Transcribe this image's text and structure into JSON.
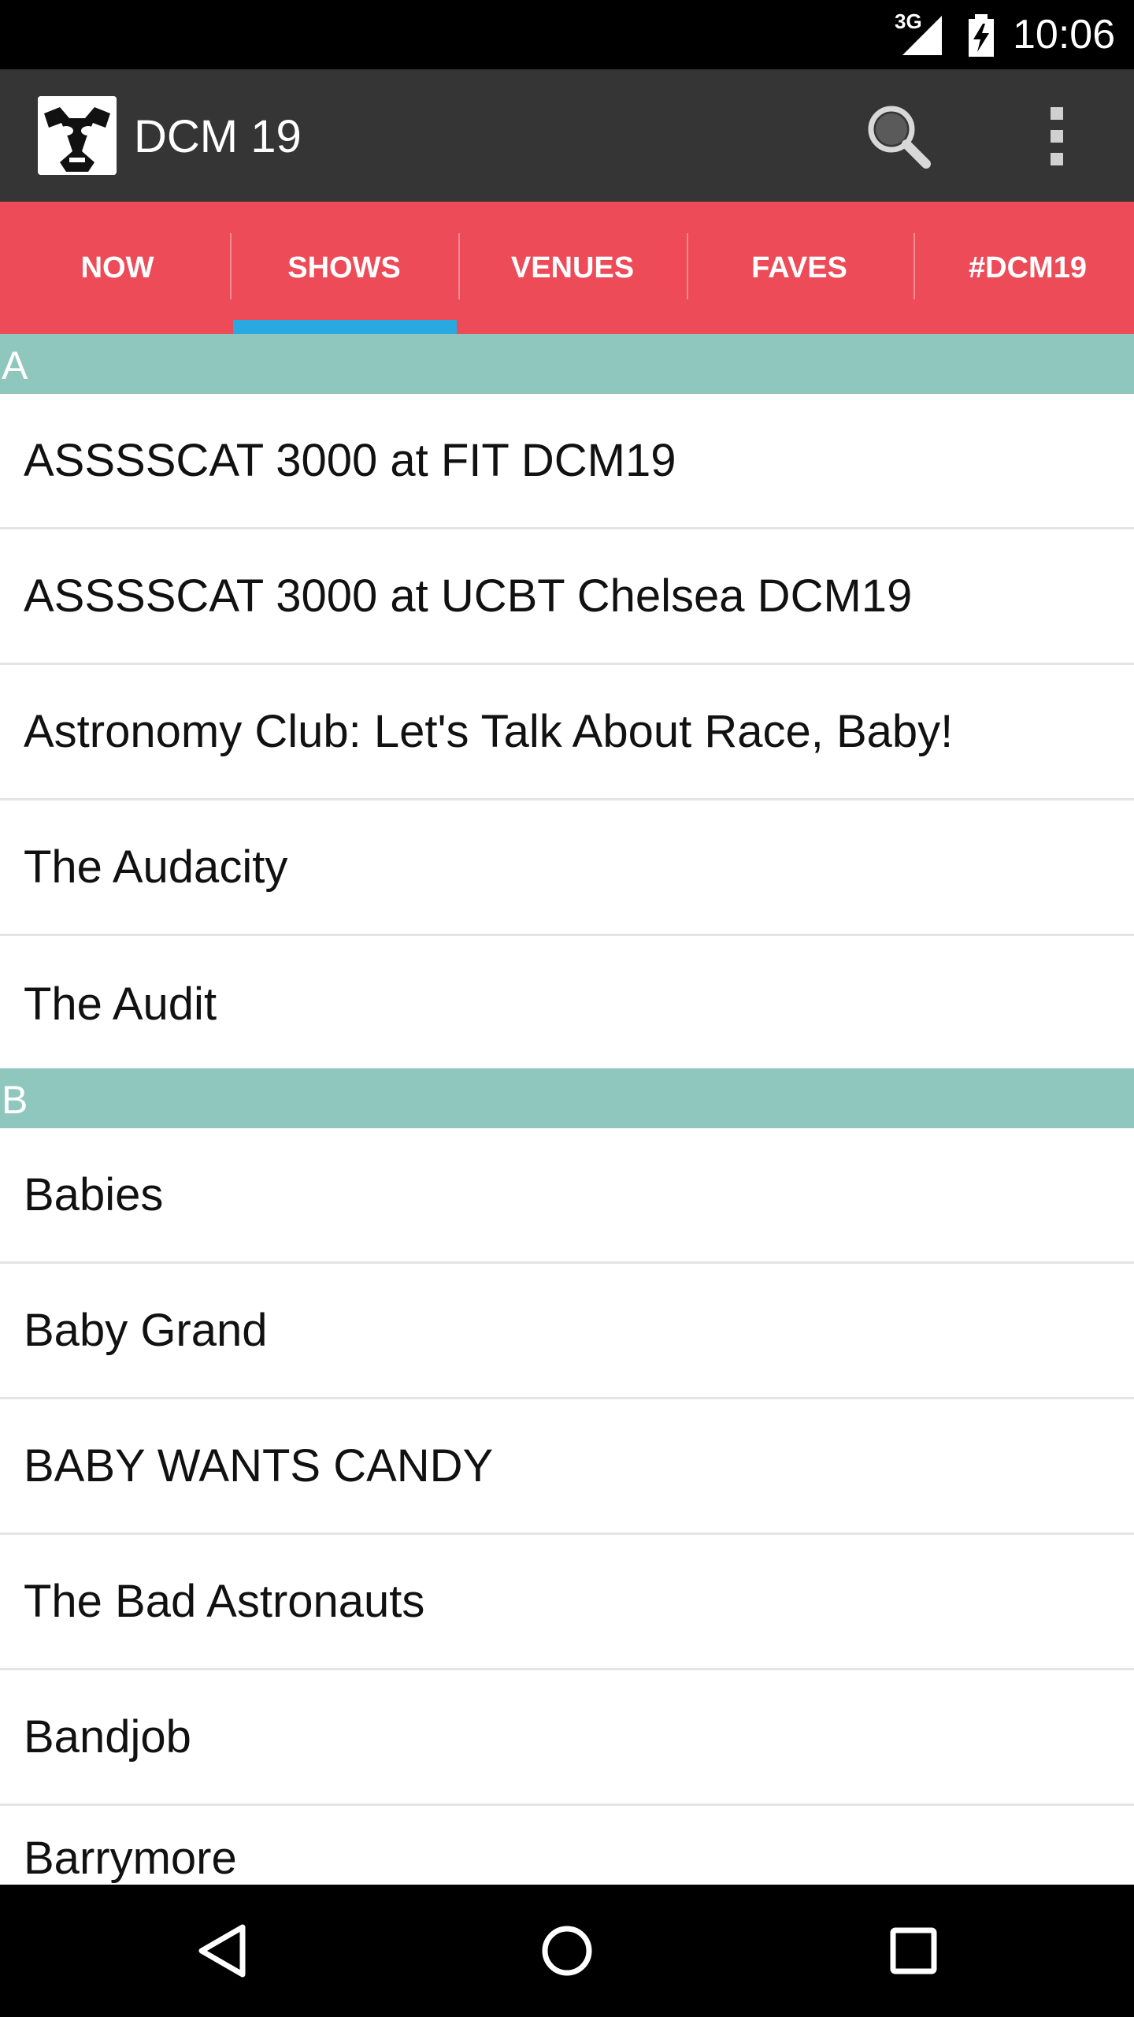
{
  "status_bar": {
    "network": "3G",
    "time": "10:06",
    "icons": [
      "signal-icon",
      "battery-charging-icon"
    ]
  },
  "app_bar": {
    "title": "DCM 19",
    "icons": [
      "app-logo-icon",
      "search-icon",
      "overflow-menu-icon"
    ]
  },
  "tabs": [
    {
      "label": "NOW",
      "selected": false
    },
    {
      "label": "SHOWS",
      "selected": true
    },
    {
      "label": "VENUES",
      "selected": false
    },
    {
      "label": "FAVES",
      "selected": false
    },
    {
      "label": "#DCM19",
      "selected": false
    }
  ],
  "sections": [
    {
      "header": "A",
      "items": [
        "ASSSSCAT 3000 at FIT DCM19",
        "ASSSSCAT 3000 at UCBT Chelsea DCM19",
        "Astronomy Club: Let's Talk About Race, Baby!",
        "The Audacity",
        "The Audit"
      ]
    },
    {
      "header": "B",
      "items": [
        "Babies",
        "Baby Grand",
        "BABY WANTS CANDY",
        "The Bad Astronauts",
        "Bandjob",
        "Barrymore"
      ]
    }
  ],
  "nav_bar": {
    "icons": [
      "back-icon",
      "home-icon",
      "recents-icon"
    ]
  },
  "colors": {
    "status_bar": "#000000",
    "app_bar": "#353535",
    "tab_bar": "#ed4b58",
    "tab_indicator": "#2aa8e0",
    "section_header": "#8fc7bf"
  }
}
